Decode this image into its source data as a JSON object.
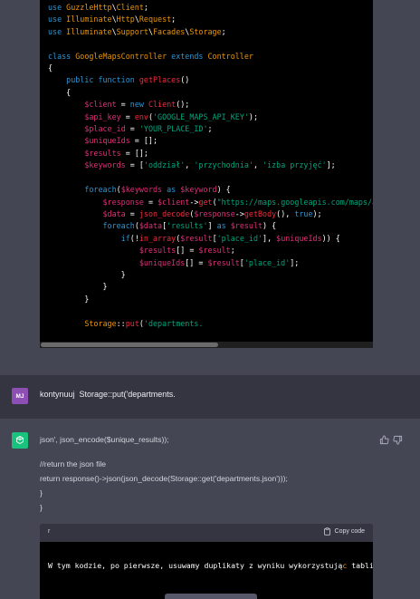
{
  "code_lines": [
    [
      {
        "c": "kw",
        "t": "use "
      },
      {
        "c": "ns",
        "t": "GuzzleHttp"
      },
      {
        "c": "",
        "t": "\\"
      },
      {
        "c": "ns",
        "t": "Client"
      },
      {
        "c": "",
        "t": ";"
      }
    ],
    [
      {
        "c": "kw",
        "t": "use "
      },
      {
        "c": "ns",
        "t": "Illuminate"
      },
      {
        "c": "",
        "t": "\\"
      },
      {
        "c": "ns",
        "t": "Http"
      },
      {
        "c": "",
        "t": "\\"
      },
      {
        "c": "ns",
        "t": "Request"
      },
      {
        "c": "",
        "t": ";"
      }
    ],
    [
      {
        "c": "kw",
        "t": "use "
      },
      {
        "c": "ns",
        "t": "Illuminate"
      },
      {
        "c": "",
        "t": "\\"
      },
      {
        "c": "ns",
        "t": "Support"
      },
      {
        "c": "",
        "t": "\\"
      },
      {
        "c": "ns",
        "t": "Facades"
      },
      {
        "c": "",
        "t": "\\"
      },
      {
        "c": "ns",
        "t": "Storage"
      },
      {
        "c": "",
        "t": ";"
      }
    ],
    [],
    [
      {
        "c": "kw",
        "t": "class "
      },
      {
        "c": "ns",
        "t": "GoogleMapsController "
      },
      {
        "c": "kw",
        "t": "extends "
      },
      {
        "c": "ns",
        "t": "Controller"
      }
    ],
    [
      {
        "c": "",
        "t": "{"
      }
    ],
    [
      {
        "c": "",
        "t": "    "
      },
      {
        "c": "kw",
        "t": "public function "
      },
      {
        "c": "fn",
        "t": "getPlaces"
      },
      {
        "c": "",
        "t": "()"
      }
    ],
    [
      {
        "c": "",
        "t": "    {"
      }
    ],
    [
      {
        "c": "",
        "t": "        "
      },
      {
        "c": "var",
        "t": "$client"
      },
      {
        "c": "",
        "t": " = "
      },
      {
        "c": "kw",
        "t": "new "
      },
      {
        "c": "fn",
        "t": "Client"
      },
      {
        "c": "",
        "t": "();"
      }
    ],
    [
      {
        "c": "",
        "t": "        "
      },
      {
        "c": "var",
        "t": "$api_key"
      },
      {
        "c": "",
        "t": " = "
      },
      {
        "c": "fn",
        "t": "env"
      },
      {
        "c": "",
        "t": "("
      },
      {
        "c": "str",
        "t": "'GOOGLE_MAPS_API_KEY'"
      },
      {
        "c": "",
        "t": ");"
      }
    ],
    [
      {
        "c": "",
        "t": "        "
      },
      {
        "c": "var",
        "t": "$place_id"
      },
      {
        "c": "",
        "t": " = "
      },
      {
        "c": "str",
        "t": "'YOUR_PLACE_ID'"
      },
      {
        "c": "",
        "t": ";"
      }
    ],
    [
      {
        "c": "",
        "t": "        "
      },
      {
        "c": "var",
        "t": "$uniqueIds"
      },
      {
        "c": "",
        "t": " = [];"
      }
    ],
    [
      {
        "c": "",
        "t": "        "
      },
      {
        "c": "var",
        "t": "$results"
      },
      {
        "c": "",
        "t": " = [];"
      }
    ],
    [
      {
        "c": "",
        "t": "        "
      },
      {
        "c": "var",
        "t": "$keywords"
      },
      {
        "c": "",
        "t": " = ["
      },
      {
        "c": "str",
        "t": "'oddział'"
      },
      {
        "c": "",
        "t": ", "
      },
      {
        "c": "str",
        "t": "'przychodnia'"
      },
      {
        "c": "",
        "t": ", "
      },
      {
        "c": "str",
        "t": "'izba przyjęć'"
      },
      {
        "c": "",
        "t": "];"
      }
    ],
    [],
    [
      {
        "c": "",
        "t": "        "
      },
      {
        "c": "kw",
        "t": "foreach"
      },
      {
        "c": "",
        "t": "("
      },
      {
        "c": "var",
        "t": "$keywords"
      },
      {
        "c": "kw",
        "t": " as "
      },
      {
        "c": "var",
        "t": "$keyword"
      },
      {
        "c": "",
        "t": ") {"
      }
    ],
    [
      {
        "c": "",
        "t": "            "
      },
      {
        "c": "var",
        "t": "$response"
      },
      {
        "c": "",
        "t": " = "
      },
      {
        "c": "var",
        "t": "$client"
      },
      {
        "c": "",
        "t": "->"
      },
      {
        "c": "fn",
        "t": "get"
      },
      {
        "c": "",
        "t": "("
      },
      {
        "c": "str",
        "t": "\"https://maps.googleapis.com/maps/api/p"
      }
    ],
    [
      {
        "c": "",
        "t": "            "
      },
      {
        "c": "var",
        "t": "$data"
      },
      {
        "c": "",
        "t": " = "
      },
      {
        "c": "fn",
        "t": "json_decode"
      },
      {
        "c": "",
        "t": "("
      },
      {
        "c": "var",
        "t": "$response"
      },
      {
        "c": "",
        "t": "->"
      },
      {
        "c": "fn",
        "t": "getBody"
      },
      {
        "c": "",
        "t": "(), "
      },
      {
        "c": "kw",
        "t": "true"
      },
      {
        "c": "",
        "t": ");"
      }
    ],
    [
      {
        "c": "",
        "t": "            "
      },
      {
        "c": "kw",
        "t": "foreach"
      },
      {
        "c": "",
        "t": "("
      },
      {
        "c": "var",
        "t": "$data"
      },
      {
        "c": "",
        "t": "["
      },
      {
        "c": "str",
        "t": "'results'"
      },
      {
        "c": "",
        "t": "] "
      },
      {
        "c": "kw",
        "t": "as "
      },
      {
        "c": "var",
        "t": "$result"
      },
      {
        "c": "",
        "t": ") {"
      }
    ],
    [
      {
        "c": "",
        "t": "                "
      },
      {
        "c": "kw",
        "t": "if"
      },
      {
        "c": "",
        "t": "(!"
      },
      {
        "c": "fn",
        "t": "in_array"
      },
      {
        "c": "",
        "t": "("
      },
      {
        "c": "var",
        "t": "$result"
      },
      {
        "c": "",
        "t": "["
      },
      {
        "c": "str",
        "t": "'place_id'"
      },
      {
        "c": "",
        "t": "], "
      },
      {
        "c": "var",
        "t": "$uniqueIds"
      },
      {
        "c": "",
        "t": ")) {"
      }
    ],
    [
      {
        "c": "",
        "t": "                    "
      },
      {
        "c": "var",
        "t": "$results"
      },
      {
        "c": "",
        "t": "[] = "
      },
      {
        "c": "var",
        "t": "$result"
      },
      {
        "c": "",
        "t": ";"
      }
    ],
    [
      {
        "c": "",
        "t": "                    "
      },
      {
        "c": "var",
        "t": "$uniqueIds"
      },
      {
        "c": "",
        "t": "[] = "
      },
      {
        "c": "var",
        "t": "$result"
      },
      {
        "c": "",
        "t": "["
      },
      {
        "c": "str",
        "t": "'place_id'"
      },
      {
        "c": "",
        "t": "];"
      }
    ],
    [
      {
        "c": "",
        "t": "                }"
      }
    ],
    [
      {
        "c": "",
        "t": "            }"
      }
    ],
    [
      {
        "c": "",
        "t": "        }"
      }
    ],
    [],
    [
      {
        "c": "",
        "t": "        "
      },
      {
        "c": "ns",
        "t": "Storage"
      },
      {
        "c": "",
        "t": "::"
      },
      {
        "c": "fn",
        "t": "put"
      },
      {
        "c": "",
        "t": "("
      },
      {
        "c": "str",
        "t": "'departments."
      }
    ]
  ],
  "user_message": {
    "avatar": "MJ",
    "text": "kontynuuj  Storage::put('departments."
  },
  "bot_message": {
    "lines": [
      "json', json_encode($unique_results));",
      "//return the json file",
      "return response()->json(json_decode(Storage::get('departments.json')));",
      "}",
      "}"
    ],
    "icons": [
      "thumbs-up-icon",
      "thumbs-down-icon"
    ]
  },
  "code_block2": {
    "language": "r",
    "copy_label": "Copy code",
    "text_before": "W tym kodzie, po pierwsze, usuwamy duplikaty z wyniku wykorzystują",
    "text_highlight": "c",
    "text_after": " tablicę"
  },
  "colors": {
    "page_bg": "#444654",
    "user_row_bg": "#343541",
    "code_bg": "#000000",
    "user_avatar": "#8e4fb5",
    "bot_avatar": "#19c37d"
  }
}
